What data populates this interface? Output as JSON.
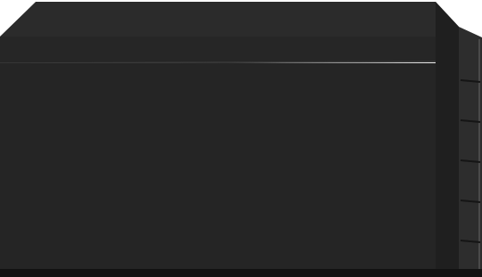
{
  "image": {
    "subject": "",
    "colors": {
      "background": "#ffffff",
      "top_face": "#2b2b2b",
      "front_face": "#252525",
      "side_face": "#1f1f1f",
      "edge_highlight": "#3a3a3a",
      "shadow": "#121212",
      "groove": "#151515"
    }
  }
}
